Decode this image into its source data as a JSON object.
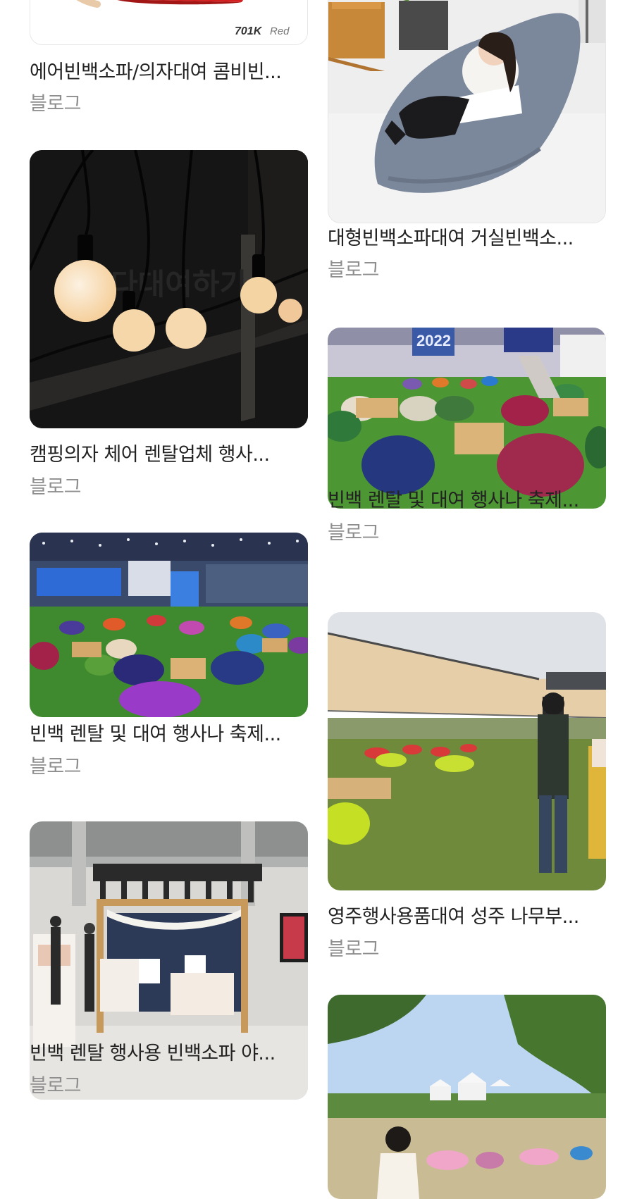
{
  "left_column": [
    {
      "title": "에어빈백소파/의자대여 콤비빈...",
      "source": "블로그",
      "image": "red-bean-bag-product-photo",
      "image_caption_parts": {
        "model": "701K",
        "color": "Red"
      }
    },
    {
      "title": "캠핑의자 체어 렌탈업체 행사...",
      "source": "블로그",
      "image": "string-lights-photo",
      "watermark": "다대여하기"
    },
    {
      "title": "빈백 렌탈 및 대여 행사나 축제...",
      "source": "블로그",
      "image": "indoor-bean-bag-event-photo"
    },
    {
      "title": "빈백 렌탈 행사용 빈백소파 야...",
      "source": "블로그",
      "image": "exhibition-booth-photo"
    }
  ],
  "right_column": [
    {
      "title": "대형빈백소파대여 거실빈백소...",
      "source": "블로그",
      "image": "woman-on-gray-bean-bag-photo"
    },
    {
      "title": "빈백 렌탈 및 대여 행사나 축제...",
      "source": "블로그",
      "image": "festival-bean-bags-on-turf-photo",
      "sign_text": "2022"
    },
    {
      "title": "영주행사용품대여 성주 나무부...",
      "source": "블로그",
      "image": "outdoor-canopy-bean-bags-photo"
    },
    {
      "title": "",
      "source": "",
      "image": "park-picnic-festival-photo"
    }
  ],
  "colors": {
    "title": "#222222",
    "source": "#8e8e8e",
    "background": "#ffffff",
    "turf_green": "#3f8a2e"
  }
}
